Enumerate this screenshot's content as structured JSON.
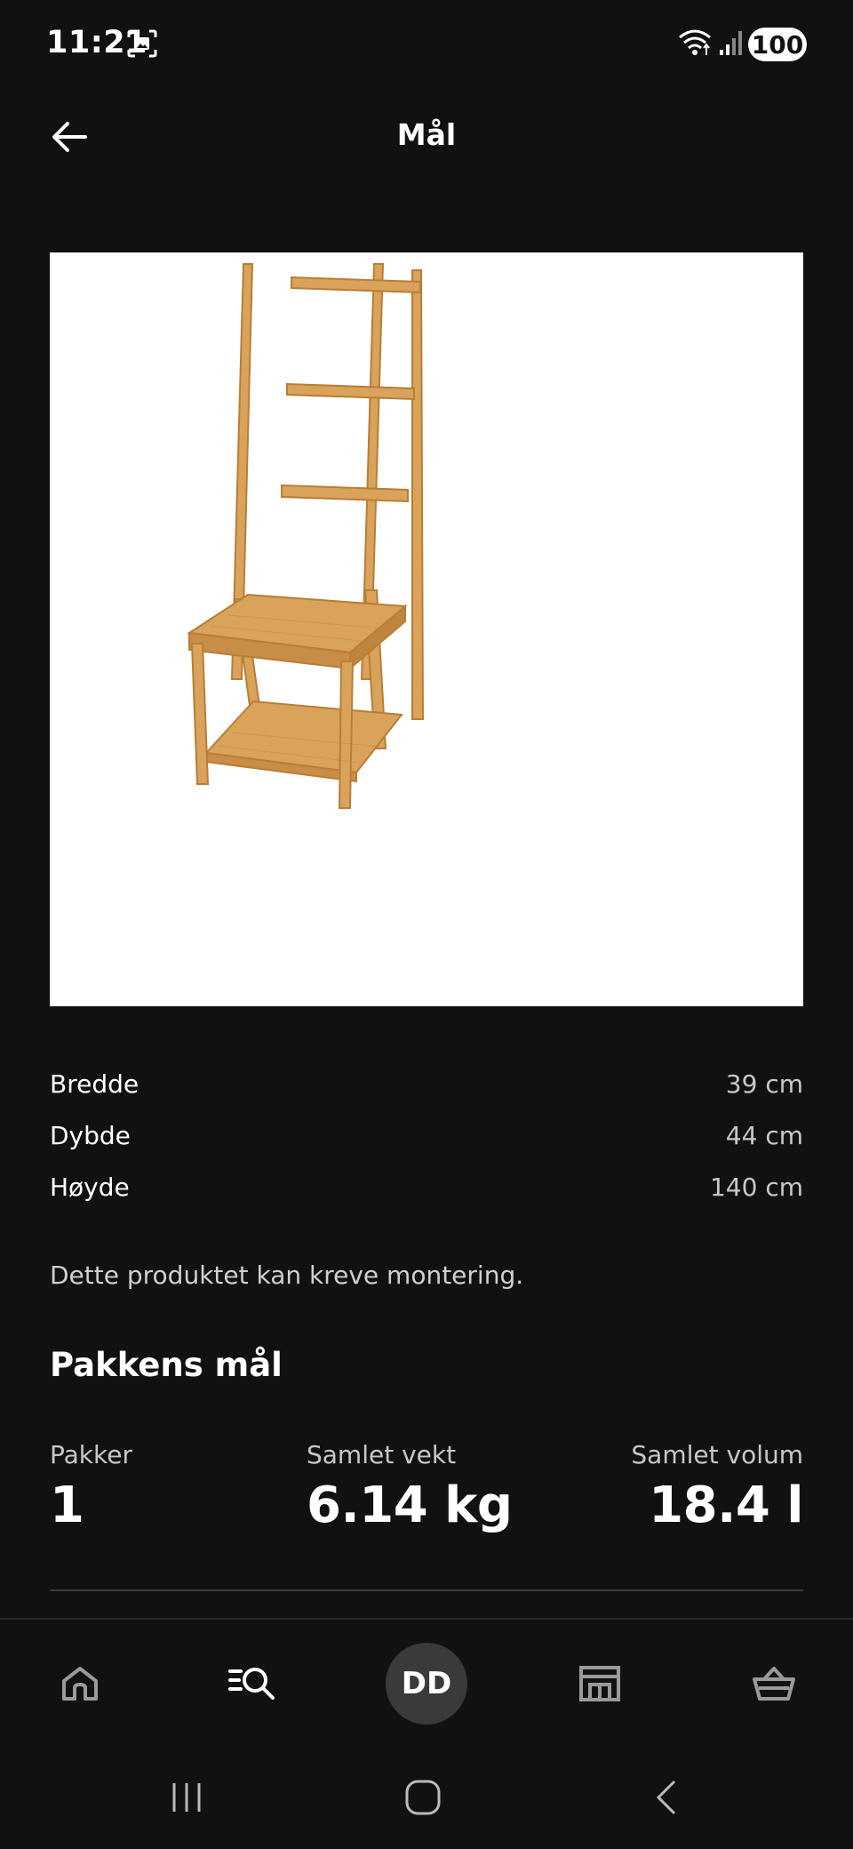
{
  "status_bar": {
    "time": "11:21",
    "battery": "100",
    "icons": [
      "screenshot-icon",
      "wifi-icon",
      "signal-icon"
    ]
  },
  "header": {
    "title": "Mål",
    "back_icon": "arrow-left-icon"
  },
  "product_image": {
    "subject": "bamboo chair with towel rack"
  },
  "dimensions": [
    {
      "label": "Bredde",
      "value": "39 cm"
    },
    {
      "label": "Dybde",
      "value": "44 cm"
    },
    {
      "label": "Høyde",
      "value": "140 cm"
    }
  ],
  "assembly_note": "Dette produktet kan kreve montering.",
  "package": {
    "heading": "Pakkens mål",
    "stats": [
      {
        "label": "Pakker",
        "value": "1"
      },
      {
        "label": "Samlet vekt",
        "value": "6.14 kg"
      },
      {
        "label": "Samlet volum",
        "value": "18.4 l"
      }
    ]
  },
  "bottom_nav": {
    "items": [
      "home-icon",
      "search-list-icon",
      "profile-avatar",
      "store-icon",
      "basket-icon"
    ],
    "avatar_initials": "DD"
  },
  "system_nav": [
    "recent-apps-icon",
    "home-button-icon",
    "back-icon"
  ],
  "colors": {
    "background": "#111111",
    "text_primary": "#ffffff",
    "text_secondary": "#c8c8c8",
    "wood": "#d9a35c"
  }
}
